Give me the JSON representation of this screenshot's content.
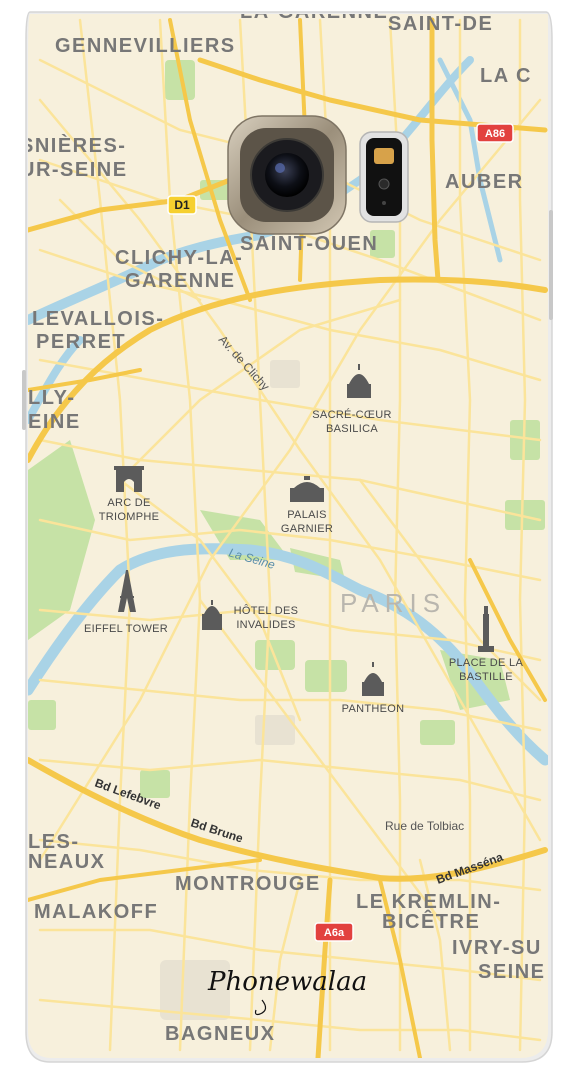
{
  "brand": {
    "logo_text": "Phonewalaa"
  },
  "map": {
    "cities": {
      "gennevilliers": "GENNEVILLIERS",
      "la_garenne_top": "LA-GARENNE",
      "saint_denis": "SAINT-DE",
      "la_c": "LA C",
      "asnieres_1": "SNIÈRES-",
      "asnieres_2": "UR-SEINE",
      "aubervilliers": "AUBER",
      "saint_ouen": "SAINT-OUEN",
      "clichy_1": "CLICHY-LA-",
      "clichy_2": "GARENNE",
      "levallois_1": "LEVALLOIS-",
      "levallois_2": "PERRET",
      "neuilly_1": "LLY-",
      "neuilly_2": "EINE",
      "paris": "PARIS",
      "les_1": "LES-",
      "les_2": "NEAUX",
      "montrouge": "MONTROUGE",
      "malakoff": "MALAKOFF",
      "kremlin_1": "LE KREMLIN-",
      "kremlin_2": "BICÊTRE",
      "ivry_1": "IVRY-SU",
      "ivry_2": "SEINE",
      "bagneux": "BAGNEUX"
    },
    "pois": [
      {
        "lines": [
          "SACRÉ-CŒUR",
          "BASILICA"
        ],
        "icon": "basilica-icon"
      },
      {
        "lines": [
          "ARC DE",
          "TRIOMPHE"
        ],
        "icon": "arc-de-triomphe-icon"
      },
      {
        "lines": [
          "PALAIS",
          "GARNIER"
        ],
        "icon": "palais-garnier-icon"
      },
      {
        "lines": [
          "EIFFEL TOWER"
        ],
        "icon": "eiffel-tower-icon"
      },
      {
        "lines": [
          "HÔTEL DES",
          "INVALIDES"
        ],
        "icon": "invalides-icon"
      },
      {
        "lines": [
          "PLACE DE LA",
          "BASTILLE"
        ],
        "icon": "bastille-column-icon"
      },
      {
        "lines": [
          "PANTHEON"
        ],
        "icon": "pantheon-icon"
      }
    ],
    "streets": {
      "av_clichy": "Av. de Clichy",
      "la_seine": "La Seine",
      "bd_lefebvre": "Bd Lefebvre",
      "bd_brune": "Bd Brune",
      "rue_tolbiac": "Rue de Tolbiac",
      "bd_massena": "Bd Masséna"
    },
    "shields": {
      "a86": "A86",
      "d1": "D1",
      "a6a": "A6a"
    }
  },
  "colors": {
    "land": "#f7f0dc",
    "road_major": "#f5c84a",
    "road_minor": "#fbe49a",
    "water": "#a9d3e6",
    "park": "#c6e2a6",
    "shield_red": "#e2413f",
    "shield_yellow": "#f6d02f",
    "camera_ring": "#a89c88"
  }
}
